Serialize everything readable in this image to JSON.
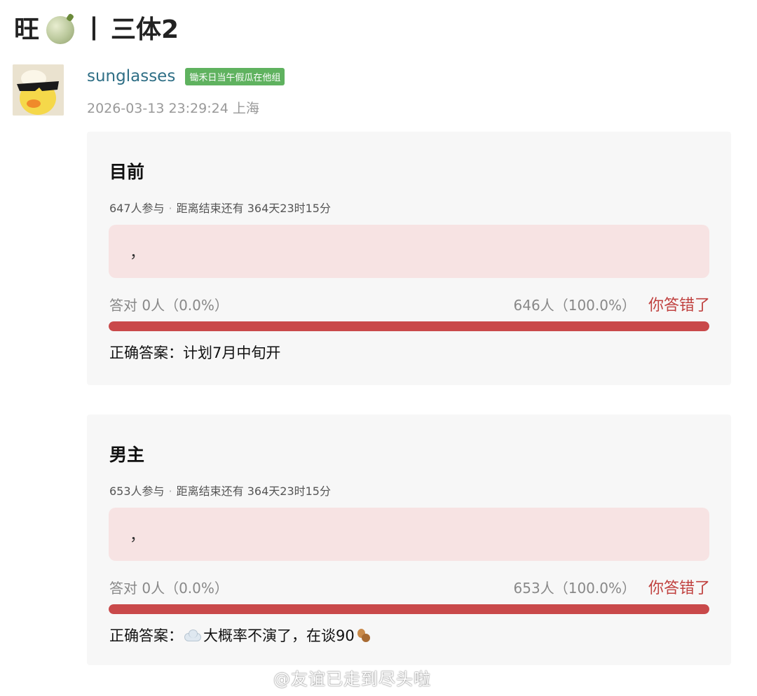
{
  "post": {
    "title_prefix": "旺",
    "title_sep": "丨",
    "title_main": "三体2",
    "author": {
      "name": "sunglasses",
      "badge": "锄禾日当午假瓜在他组"
    },
    "timestamp": "2026-03-13 23:29:24",
    "location": "上海"
  },
  "polls": [
    {
      "question": "目前",
      "participants": "647人参与",
      "time_left": "距离结束还有 364天23时15分",
      "answer_text": "，",
      "correct_label": "答对",
      "correct_stat": "0人（0.0%）",
      "wrong_stat": "646人（100.0%）",
      "wrong_label": "你答错了",
      "wrong_fraction": 1.0,
      "correct_answer_label": "正确答案：",
      "correct_answer": "计划7月中旬开"
    },
    {
      "question": "男主",
      "participants": "653人参与",
      "time_left": "距离结束还有 364天23时15分",
      "answer_text": "，",
      "correct_label": "答对",
      "correct_stat": "0人（0.0%）",
      "wrong_stat": "653人（100.0%）",
      "wrong_label": "你答错了",
      "wrong_fraction": 1.0,
      "correct_answer_label": "正确答案：",
      "correct_answer": "大概率不演了，在谈90"
    }
  ],
  "watermark": "@友谊已走到尽头啦",
  "icons": {
    "title_icon": "melon-icon",
    "answer2_prefix_icon": "cloud-icon",
    "answer2_suffix_icon": "peanut-icon"
  },
  "colors": {
    "author_name": "#2f6f86",
    "badge_bg": "#5fb25f",
    "wrong": "#c0413f",
    "bar_fill": "#c9494a",
    "answer_bg": "#f7e3e3"
  }
}
